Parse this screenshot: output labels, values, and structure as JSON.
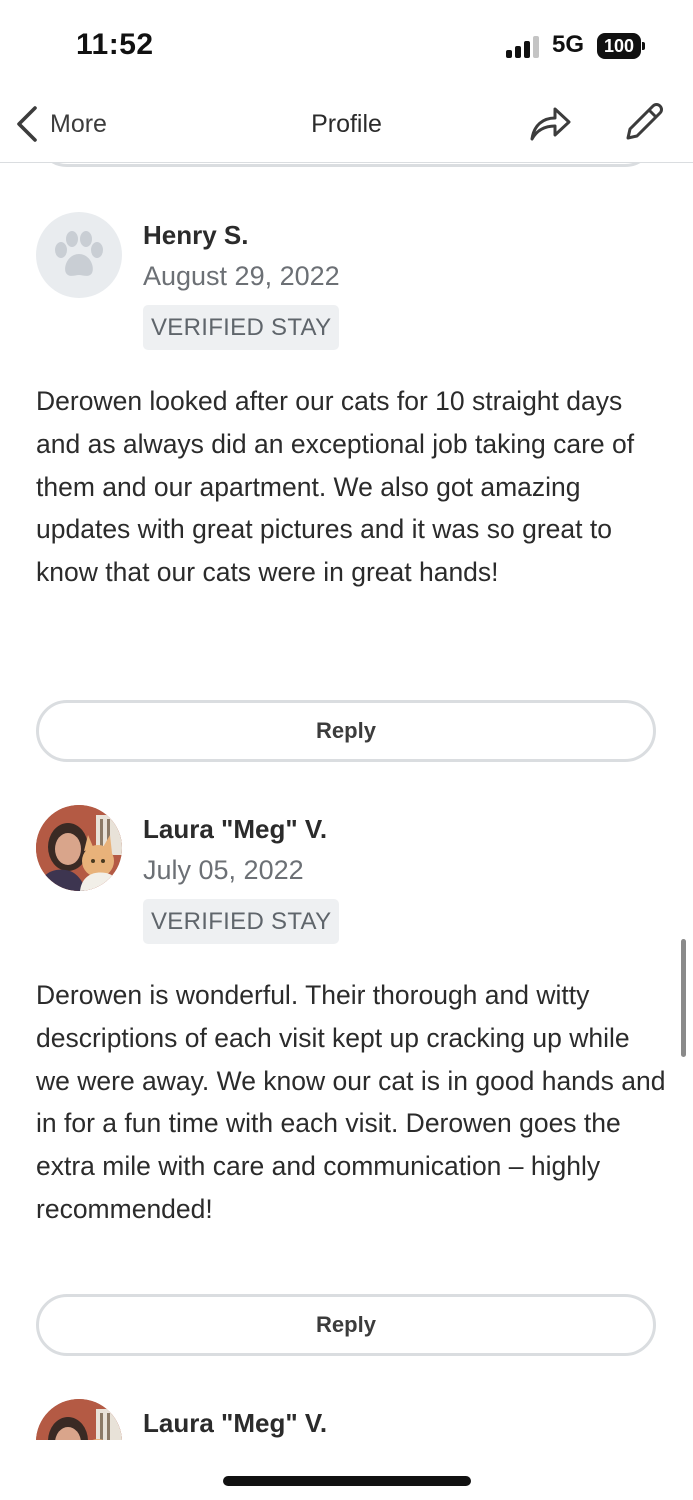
{
  "status_bar": {
    "time": "11:52",
    "network": "5G",
    "battery": "100"
  },
  "nav": {
    "back_label": "More",
    "title": "Profile",
    "share_icon": "share-arrow-icon",
    "edit_icon": "pencil-icon"
  },
  "reviews": [
    {
      "name": "Henry S.",
      "date": "August 29, 2022",
      "badge": "VERIFIED STAY",
      "avatar": "paw-icon",
      "text": "Derowen looked after our cats for 10 straight days and as always did an exceptional job taking care of them and our apartment. We also got amazing updates with great pictures and it was so great to know that our cats were in great hands!",
      "reply_label": "Reply"
    },
    {
      "name": "Laura \"Meg\" V.",
      "date": "July 05, 2022",
      "badge": "VERIFIED STAY",
      "avatar": "user-photo",
      "text": "Derowen is wonderful. Their thorough and witty descriptions of each visit kept up cracking up while we were away. We know our cat is in good hands and in for a fun time with each visit. Derowen goes the extra mile with care and communication – highly recommended!",
      "reply_label": "Reply"
    },
    {
      "name": "Laura \"Meg\" V.",
      "avatar": "user-photo"
    }
  ]
}
